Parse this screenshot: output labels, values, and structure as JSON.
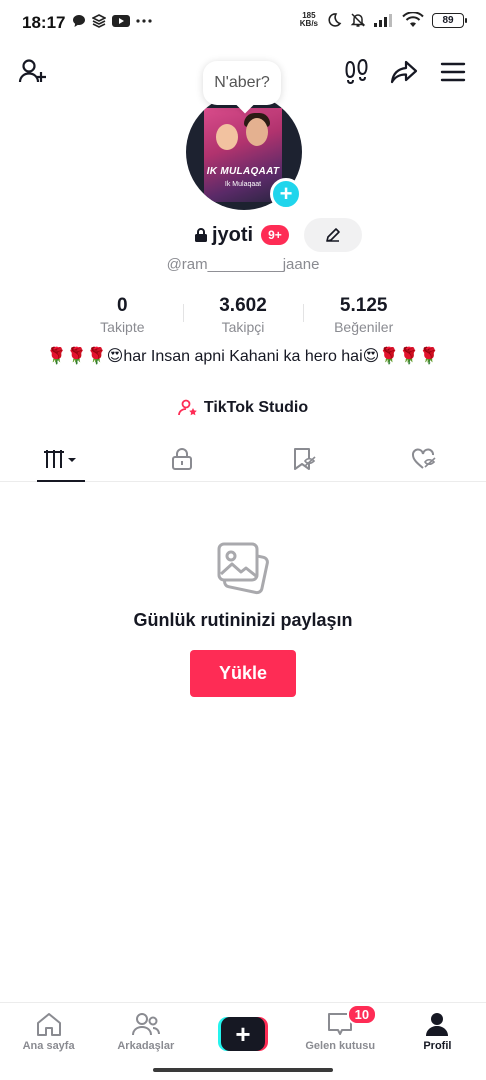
{
  "status_bar": {
    "time": "18:17",
    "net_speed_value": "185",
    "net_speed_unit": "KB/s",
    "battery": "89",
    "icons": [
      "chat-bubble-icon",
      "layers-icon",
      "youtube-icon",
      "more-dots-icon",
      "moon-icon",
      "bell-off-icon",
      "signal-icon",
      "wifi-icon"
    ]
  },
  "topbar": {
    "icons": [
      "add-friend-icon",
      "footprints-icon",
      "share-icon",
      "menu-icon"
    ]
  },
  "note": {
    "text": "N'aber?"
  },
  "avatar": {
    "title": "IK MULAQAAT",
    "subtitle": "Ik Mulaqaat"
  },
  "profile": {
    "username": "jyoti",
    "notifications_badge": "9+",
    "handle": "@ram_________jaane"
  },
  "stats": [
    {
      "value": "0",
      "label": "Takipte"
    },
    {
      "value": "3.602",
      "label": "Takipçi"
    },
    {
      "value": "5.125",
      "label": "Beğeniler"
    }
  ],
  "bio": "🌹🌹🌹😍har Insan apni Kahani ka hero hai😍🌹🌹🌹",
  "studio": {
    "label": "TikTok Studio"
  },
  "tabs": [
    {
      "id": "videos",
      "icon": "grid-icon",
      "active": true
    },
    {
      "id": "private",
      "icon": "lock-icon",
      "active": false
    },
    {
      "id": "favorites",
      "icon": "bookmark-hidden-icon",
      "active": false
    },
    {
      "id": "liked",
      "icon": "heart-hidden-icon",
      "active": false
    }
  ],
  "empty_state": {
    "title": "Günlük rutininizi paylaşın",
    "button": "Yükle"
  },
  "bottom_nav": {
    "home": "Ana sayfa",
    "friends": "Arkadaşlar",
    "create": "+",
    "inbox": "Gelen kutusu",
    "inbox_badge": "10",
    "profile": "Profil"
  },
  "colors": {
    "accent": "#fe2c55",
    "cyan": "#20d5ec",
    "text": "#161823",
    "muted": "#8a8b91"
  }
}
